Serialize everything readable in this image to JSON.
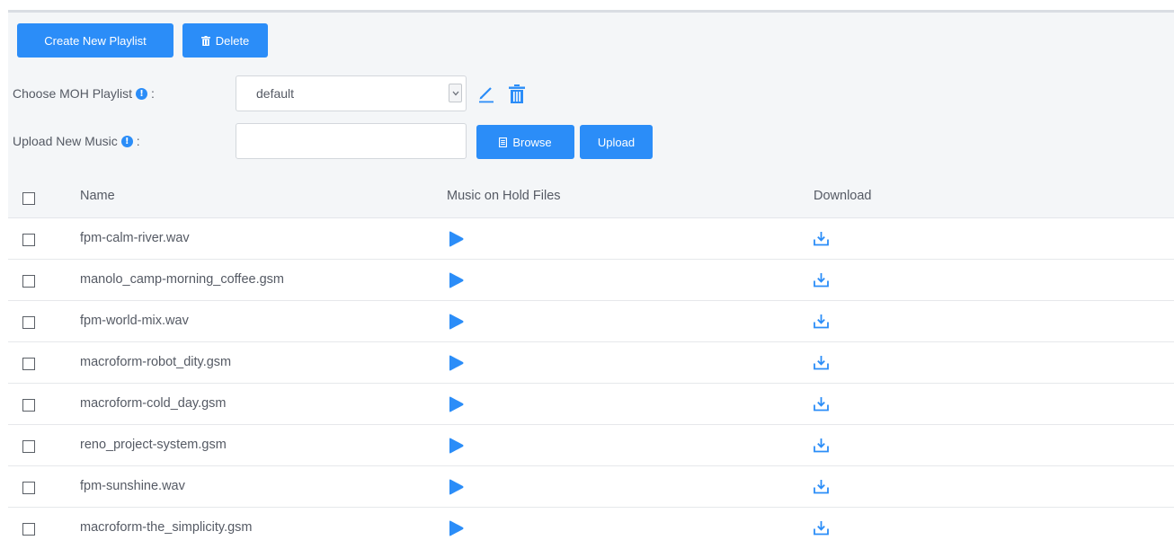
{
  "toolbar": {
    "create_label": "Create New Playlist",
    "delete_label": "Delete"
  },
  "form": {
    "moh_label": "Choose MOH Playlist",
    "moh_value": "default",
    "upload_label": "Upload New Music",
    "colon": ":",
    "info_glyph": "!",
    "browse_label": "Browse",
    "upload_button_label": "Upload"
  },
  "table": {
    "columns": [
      "Name",
      "Music on Hold Files",
      "Download"
    ],
    "rows": [
      {
        "name": "fpm-calm-river.wav"
      },
      {
        "name": "manolo_camp-morning_coffee.gsm"
      },
      {
        "name": "fpm-world-mix.wav"
      },
      {
        "name": "macroform-robot_dity.gsm"
      },
      {
        "name": "macroform-cold_day.gsm"
      },
      {
        "name": "reno_project-system.gsm"
      },
      {
        "name": "fpm-sunshine.wav"
      },
      {
        "name": "macroform-the_simplicity.gsm"
      }
    ]
  },
  "colors": {
    "accent": "#2b8df8",
    "panel_bg": "#f4f6f8",
    "text": "#555a64"
  },
  "icons": {
    "edit": "pencil-icon",
    "trash": "trash-icon",
    "play": "play-icon",
    "download": "download-icon",
    "info": "info-icon",
    "browse": "file-icon"
  }
}
